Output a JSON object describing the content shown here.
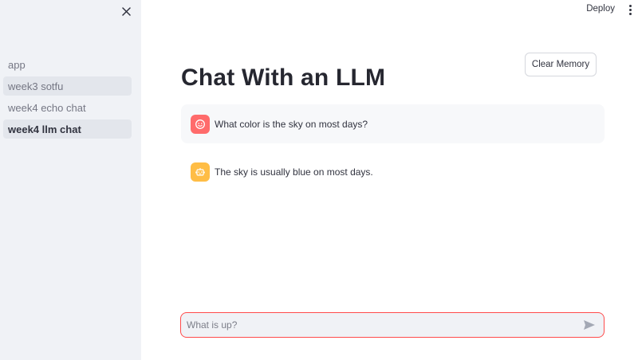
{
  "header": {
    "deploy_label": "Deploy",
    "menu_icon": "more-vertical-icon"
  },
  "sidebar": {
    "close_icon": "close-icon",
    "items": [
      {
        "label": "app",
        "state": "normal"
      },
      {
        "label": "week3 sotfu",
        "state": "hover"
      },
      {
        "label": "week4 echo chat",
        "state": "normal"
      },
      {
        "label": "week4 llm chat",
        "state": "active"
      }
    ]
  },
  "main": {
    "title": "Chat With an LLM",
    "clear_button_label": "Clear Memory",
    "messages": [
      {
        "role": "user",
        "avatar_icon": "user-face-icon",
        "avatar_color": "#ff6b6b",
        "text": "What color is the sky on most days?"
      },
      {
        "role": "assistant",
        "avatar_icon": "robot-icon",
        "avatar_color": "#ffbd45",
        "text": "The sky is usually blue on most days."
      }
    ],
    "chat_input": {
      "placeholder": "What is up?",
      "value": "",
      "send_icon": "send-icon"
    }
  },
  "colors": {
    "accent": "#ff4b4b",
    "sidebar_bg": "#f0f2f6"
  }
}
